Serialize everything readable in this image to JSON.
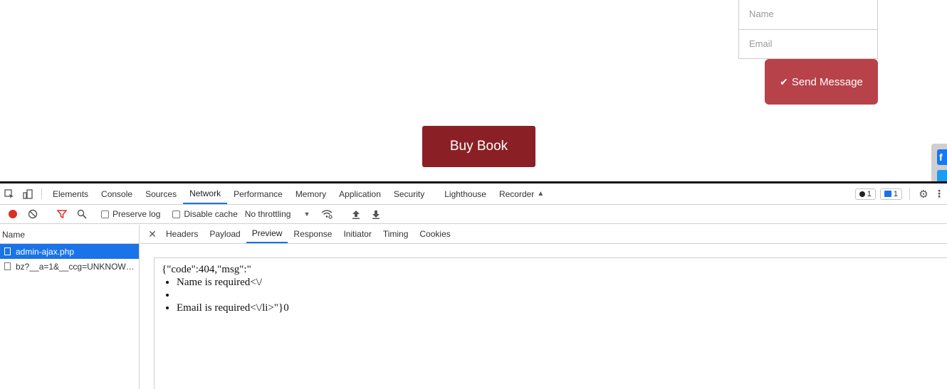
{
  "page": {
    "form": {
      "name_placeholder": "Name",
      "email_placeholder": "Email",
      "send_label": "Send Message",
      "send_icon": "check-icon"
    },
    "buy_label": "Buy Book",
    "social": [
      "facebook-icon",
      "twitter-icon"
    ]
  },
  "devtools": {
    "tabs": [
      "Elements",
      "Console",
      "Sources",
      "Network",
      "Performance",
      "Memory",
      "Application",
      "Security",
      "Lighthouse",
      "Recorder"
    ],
    "active_tab": "Network",
    "issues": {
      "errors": "1",
      "messages": "1"
    },
    "toolbar": {
      "preserve_log": "Preserve log",
      "disable_cache": "Disable cache",
      "throttling": "No throttling"
    },
    "requests": {
      "header": "Name",
      "items": [
        {
          "name": "admin-ajax.php",
          "selected": true
        },
        {
          "name": "bz?__a=1&__ccg=UNKNOWN&...",
          "selected": false
        }
      ]
    },
    "detail_tabs": [
      "Headers",
      "Payload",
      "Preview",
      "Response",
      "Initiator",
      "Timing",
      "Cookies"
    ],
    "active_detail_tab": "Preview",
    "preview": {
      "line0": "{\"code\":404,\"msg\":\"",
      "items": [
        "Name is required<\\/",
        "",
        "Email is required<\\/li>\"}0"
      ]
    }
  },
  "colors": {
    "send_button": "#b7424a",
    "buy_button": "#8a2025",
    "selection": "#1a73e8",
    "record": "#d93025"
  }
}
